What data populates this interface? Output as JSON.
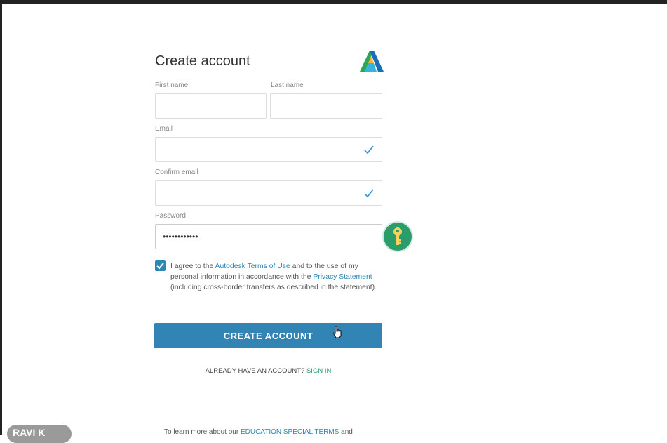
{
  "form": {
    "title": "Create account",
    "first_name_label": "First name",
    "last_name_label": "Last name",
    "email_label": "Email",
    "confirm_email_label": "Confirm email",
    "password_label": "Password",
    "password_value": "••••••••••••",
    "agree_prefix": "I agree to the ",
    "agree_link_terms": "Autodesk Terms of Use",
    "agree_mid": " and to the use of my personal information in accordance with the ",
    "agree_link_privacy": "Privacy Statement",
    "agree_suffix": " (including cross-border transfers as described in the statement).",
    "agree_checked": true,
    "create_button_label": "CREATE ACCOUNT",
    "already_text": "ALREADY HAVE AN ACCOUNT? ",
    "sign_in_label": "SIGN IN",
    "learn_prefix": "To learn more about our ",
    "learn_link": "EDUCATION SPECIAL TERMS",
    "learn_suffix": " and"
  },
  "watermark": {
    "text": "RAVI K"
  },
  "colors": {
    "accent": "#3184b4",
    "green": "#2a9d6a",
    "check": "#3a9bd5"
  },
  "icons": {
    "logo": "autodesk-logo-icon",
    "check": "check-icon",
    "key": "key-icon"
  }
}
